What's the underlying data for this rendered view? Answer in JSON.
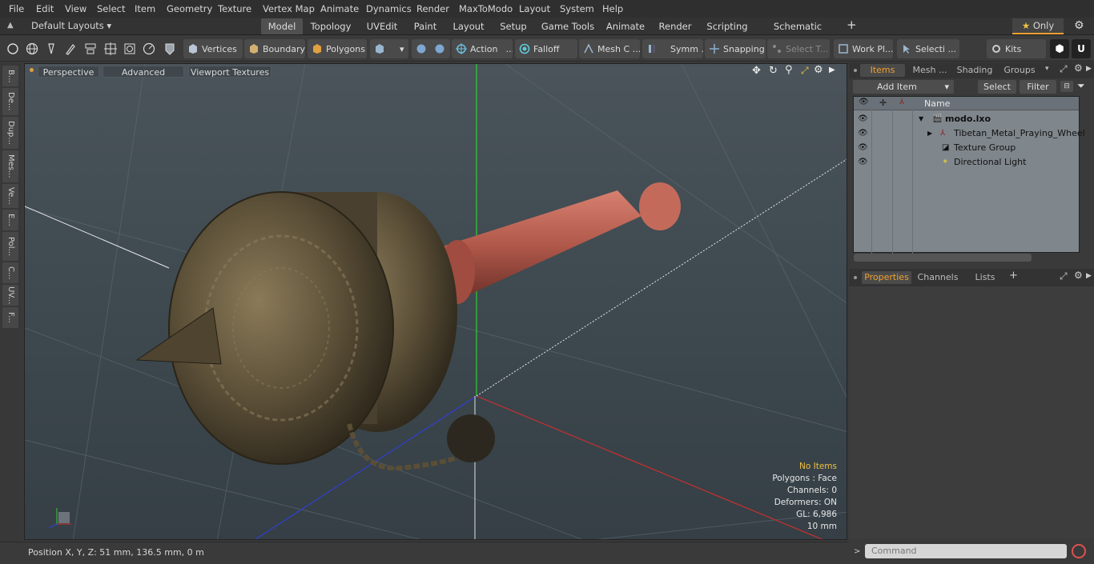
{
  "menubar": {
    "items": [
      "File",
      "Edit",
      "View",
      "Select",
      "Item",
      "Geometry",
      "Texture",
      "Vertex Map",
      "Animate",
      "Dynamics",
      "Render",
      "MaxToModo",
      "Layout",
      "System",
      "Help"
    ]
  },
  "layouts": {
    "label": "Default Layouts"
  },
  "tabs": [
    "Model",
    "Topology",
    "UVEdit",
    "Paint",
    "Layout",
    "Setup",
    "Game Tools",
    "Animate",
    "Render",
    "Scripting",
    "Schematic Fusion"
  ],
  "tabs_active": "Model",
  "only_label": "Only",
  "toolbar": {
    "vertices": "Vertices",
    "boundary": "Boundary",
    "polygons": "Polygons",
    "action": "Action",
    "falloff": "Falloff",
    "mesh": "Mesh C ...",
    "symm": "Symm ...",
    "snapping": "Snapping",
    "select_t": "Select T...",
    "work_pl": "Work Pl...",
    "selecti": "Selecti ...",
    "kits": "Kits"
  },
  "left_tabs": [
    "B...",
    "De...",
    "Dup...",
    "Mes...",
    "Ve...",
    "E...",
    "Pol...",
    "C...",
    "UV...",
    "F..."
  ],
  "viewport": {
    "perspective": "Perspective",
    "advanced": "Advanced",
    "viewport_textures": "Viewport Textures"
  },
  "info": {
    "no_items": "No Items",
    "polygons": "Polygons : Face",
    "channels": "Channels: 0",
    "deformers": "Deformers: ON",
    "gl": "GL: 6,986",
    "scale": "10 mm"
  },
  "status": {
    "position": "Position X, Y, Z:   51 mm, 136.5 mm, 0 m"
  },
  "panel": {
    "tabs": [
      "Items",
      "Mesh ...",
      "Shading",
      "Groups"
    ],
    "add_item": "Add Item",
    "select": "Select",
    "filter": "Filter",
    "name_col": "Name",
    "items": [
      {
        "label": "modo.lxo",
        "bold": true
      },
      {
        "label": "Tibetan_Metal_Praying_Wheel"
      },
      {
        "label": "Texture Group"
      },
      {
        "label": "Directional Light"
      }
    ],
    "bottom_tabs": [
      "Properties",
      "Channels",
      "Lists"
    ]
  },
  "command": {
    "placeholder": "Command"
  },
  "colors": {
    "accent": "#f0a030",
    "grid_red": "#c83030",
    "grid_green": "#30d030",
    "grid_blue": "#3040d0"
  }
}
